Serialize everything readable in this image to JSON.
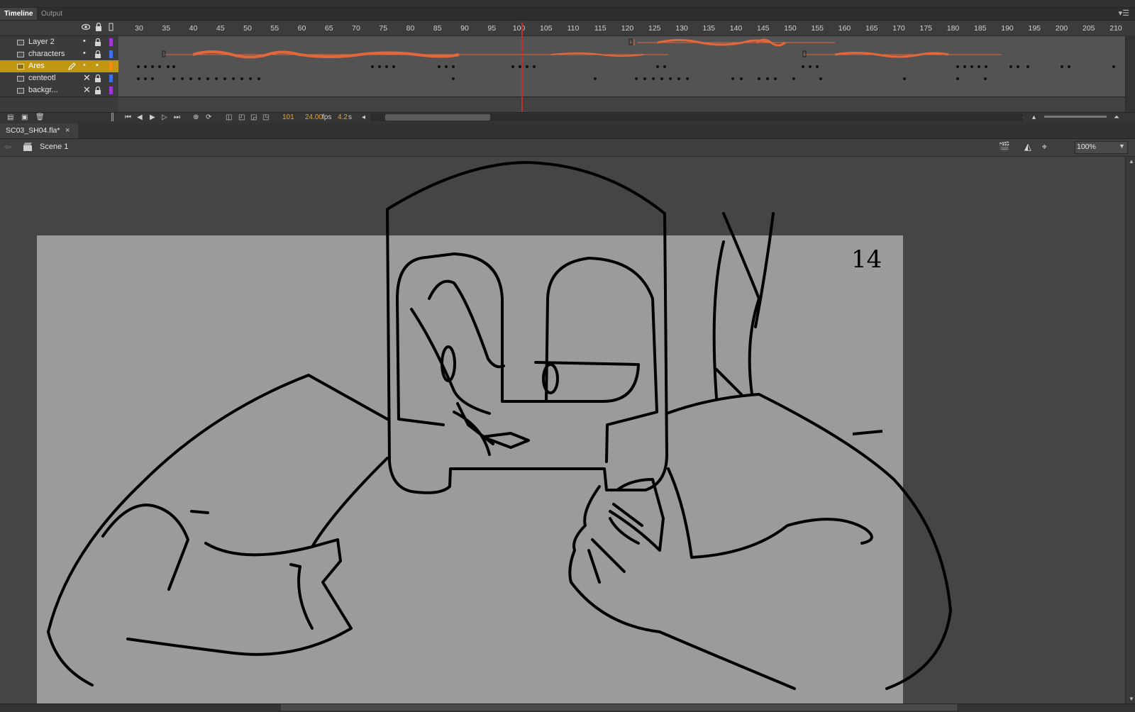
{
  "panel_tabs": [
    {
      "label": "Timeline",
      "active": true
    },
    {
      "label": "Output",
      "active": false
    }
  ],
  "panel_menu_icon": "panel-menu-icon",
  "timeline": {
    "ruler_ticks": [
      "30",
      "35",
      "40",
      "45",
      "50",
      "55",
      "60",
      "65",
      "70",
      "75",
      "80",
      "85",
      "90",
      "95",
      "100",
      "105",
      "110",
      "115",
      "120",
      "125",
      "130",
      "135",
      "140",
      "145",
      "150",
      "155",
      "160",
      "165",
      "170",
      "175",
      "180",
      "185",
      "190",
      "195",
      "200",
      "205",
      "210"
    ],
    "current_frame": "101",
    "fps": "24.00",
    "fps_unit": "fps",
    "elapsed": "4.2",
    "elapsed_unit": "s",
    "layers": [
      {
        "name": "Layer 2",
        "visible": "•",
        "color": "#9b3bd4",
        "selected": false,
        "hidden": false,
        "audio": true
      },
      {
        "name": "characters",
        "visible": "•",
        "color": "#3c6ff0",
        "selected": false,
        "hidden": false,
        "audio": true
      },
      {
        "name": "Ares",
        "visible": "•",
        "color": "#f08d12",
        "selected": true,
        "hidden": false,
        "audio": false
      },
      {
        "name": "centeotl",
        "visible": "✕",
        "color": "#3c6ff0",
        "selected": false,
        "hidden": true,
        "audio": false
      },
      {
        "name": "backgr...",
        "visible": "✕",
        "color": "#9b3bd4",
        "selected": false,
        "hidden": true,
        "audio": false
      }
    ]
  },
  "document": {
    "tab_title": "SC03_SH04.fla*",
    "close_glyph": "×",
    "scene": "Scene 1",
    "zoom": "100%",
    "scene_number": "14"
  },
  "colors": {
    "audio_wave": "#e0683c",
    "playhead": "#c0302a",
    "selected_layer": "#c19712",
    "stage": "#9b9b9b",
    "pasteboard": "#454545"
  }
}
